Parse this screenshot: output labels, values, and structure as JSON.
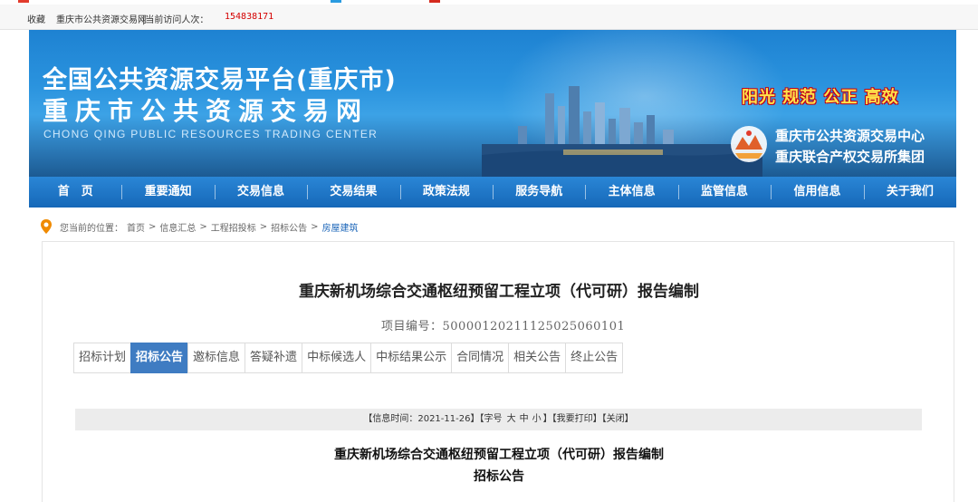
{
  "top_bar": {
    "favorite": "收藏",
    "site_link": "重庆市公共资源交易网",
    "visits_label": "|当前访问人次：",
    "visits_count": "154838171",
    "count_color": "#d40000"
  },
  "banner": {
    "title_line1": "全国公共资源交易平台(重庆市)",
    "title_line2": "重庆市公共资源交易网",
    "title_en": "CHONG QING PUBLIC RESOURCES TRADING CENTER",
    "slogan": "阳光 规范 公正 高效",
    "org_line1": "重庆市公共资源交易中心",
    "org_line2": "重庆联合产权交易所集团",
    "logo_icon": "trading-center-logo-icon"
  },
  "nav": {
    "items": [
      {
        "label": "首　页"
      },
      {
        "label": "重要通知"
      },
      {
        "label": "交易信息"
      },
      {
        "label": "交易结果"
      },
      {
        "label": "政策法规"
      },
      {
        "label": "服务导航"
      },
      {
        "label": "主体信息"
      },
      {
        "label": "监管信息"
      },
      {
        "label": "信用信息"
      },
      {
        "label": "关于我们"
      }
    ]
  },
  "breadcrumb": {
    "prefix": "您当前的位置：",
    "items": [
      "首页",
      "信息汇总",
      "工程招投标",
      "招标公告",
      "房屋建筑"
    ],
    "separator": ">",
    "icon": "location-pin-icon"
  },
  "project": {
    "title": "重庆新机场综合交通枢纽预留工程立项（代可研）报告编制",
    "code_label": "项目编号：",
    "code": "500001202111250250601​01"
  },
  "tabs": {
    "active_index": 1,
    "items": [
      {
        "label": "招标计划"
      },
      {
        "label": "招标公告"
      },
      {
        "label": "邀标信息"
      },
      {
        "label": "答疑补遗"
      },
      {
        "label": "中标候选人"
      },
      {
        "label": "中标结果公示"
      },
      {
        "label": "合同情况"
      },
      {
        "label": "相关公告"
      },
      {
        "label": "终止公告"
      }
    ]
  },
  "info_bar": {
    "time_label": "【信息时间：",
    "time_value": "2021-11-26",
    "close_time": "】",
    "font_label": "【字号",
    "font_big": "大",
    "font_mid": "中",
    "font_small": "小",
    "close_font": "】",
    "print": "【我要打印】",
    "close": "【关闭】"
  },
  "document": {
    "title": "重庆新机场综合交通枢纽预留工程立项（代可研）报告编制",
    "subtitle": "招标公告"
  },
  "colors": {
    "nav_blue": "#1668b8",
    "active_tab": "#3f7cc2",
    "slogan_yellow": "#ffe34a",
    "link_blue": "#1a64b8"
  }
}
